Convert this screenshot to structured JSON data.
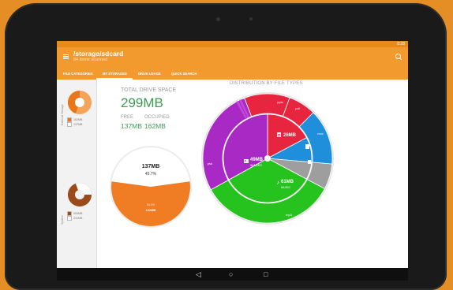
{
  "status": {
    "time": "8:28"
  },
  "appbar": {
    "title": "/storage/sdcard",
    "subtitle": "84 items scanned"
  },
  "tabs": [
    {
      "label": "FILE CATEGORIES"
    },
    {
      "label": "MY STORAGES"
    },
    {
      "label": "DRIVE USAGE"
    },
    {
      "label": "QUICK SEARCH"
    }
  ],
  "sidebar": {
    "external": {
      "label": "External Storage",
      "legend": [
        {
          "text": "162MB",
          "color": "#e8771b"
        },
        {
          "text": "137MB",
          "color": "#ffffff"
        }
      ]
    },
    "system": {
      "label": "System",
      "legend": [
        {
          "text": "593MB",
          "color": "#9a4a1b"
        },
        {
          "text": "231MB",
          "color": "#ffffff"
        }
      ]
    }
  },
  "summary": {
    "total_label": "TOTAL DRIVE SPACE",
    "total_value": "299MB",
    "free_label": "FREE",
    "occupied_label": "OCCUPIED",
    "free_value": "137MB",
    "occupied_value": "162MB"
  },
  "drive_pie": {
    "free_text": "137MB",
    "free_percent": "45.7%",
    "used_percent": "54.3%",
    "used_text": "162MB",
    "used_fraction": 0.543,
    "colors": {
      "used": "#f07d24",
      "free": "#ffffff"
    }
  },
  "distribution": {
    "title": "DISTRIBUTION BY FILE TYPES",
    "inner": [
      {
        "value": "26MB",
        "label": "",
        "color": "#e8253f",
        "icon": "document-icon"
      },
      {
        "value": "",
        "label": "",
        "color": "#1f8fdc",
        "icon": "video-icon"
      },
      {
        "value": "",
        "label": "",
        "color": "#9e9e9e",
        "icon": "file-icon"
      },
      {
        "value": "61MB",
        "label": "MUSIC",
        "color": "#26c21d",
        "icon": "music-icon"
      },
      {
        "value": "49MB",
        "label": "IMAGES",
        "color": "#a829c4",
        "icon": "image-icon"
      }
    ],
    "outer": [
      {
        "label": "pptx",
        "color": "#e8253f"
      },
      {
        "label": "pdf",
        "color": "#e8253f"
      },
      {
        "label": "mov",
        "color": "#1f8fdc"
      },
      {
        "label": "",
        "color": "#9e9e9e"
      },
      {
        "label": "mp3",
        "color": "#26c21d"
      },
      {
        "label": "psd",
        "color": "#a829c4"
      }
    ]
  },
  "fab": {
    "symbol": "+"
  },
  "nav": {
    "back": "◁",
    "home": "○",
    "recents": "□"
  }
}
